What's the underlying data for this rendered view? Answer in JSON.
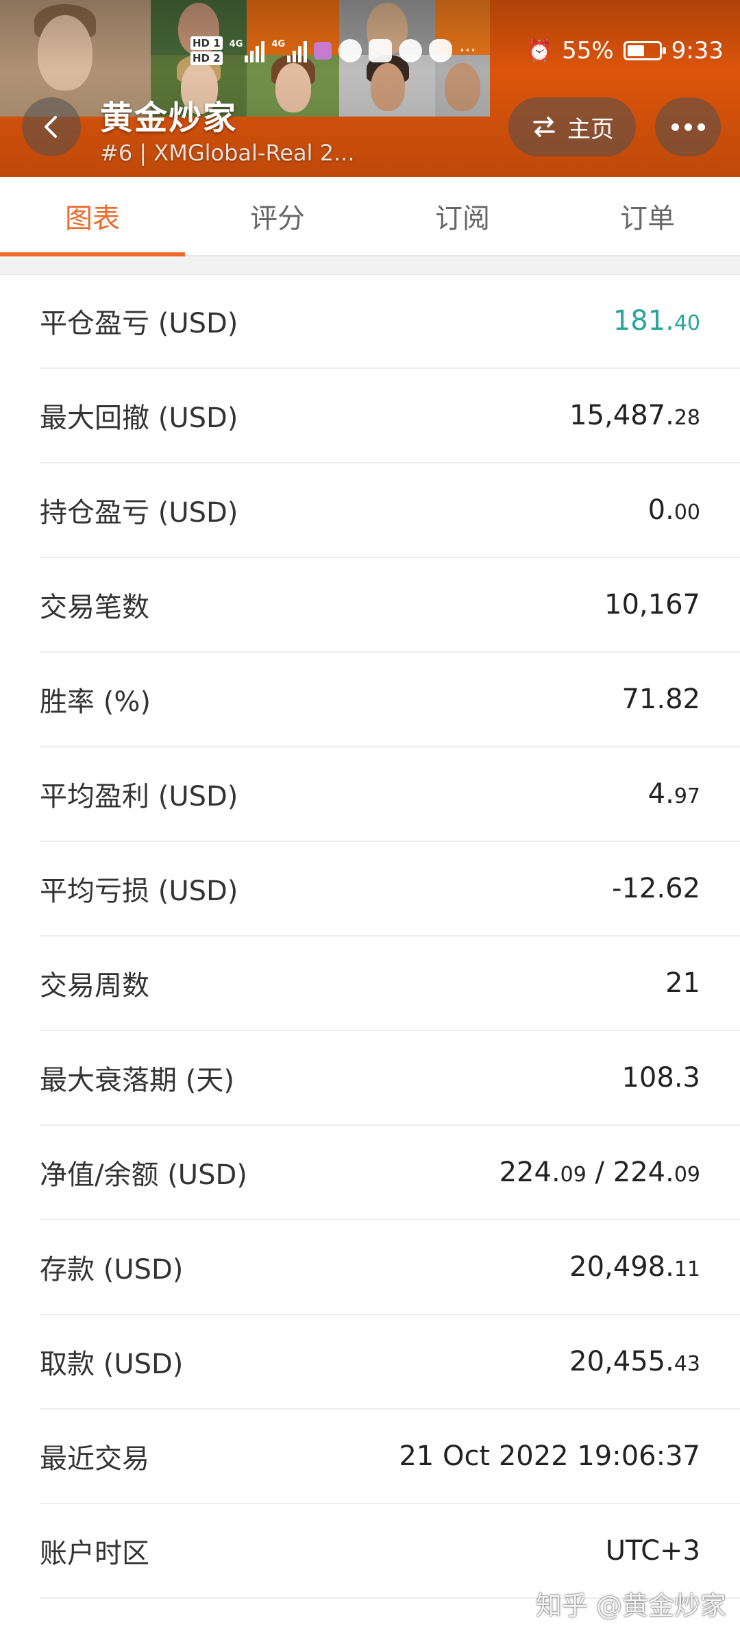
{
  "status_bar": {
    "sim1": "HD 1",
    "sim2": "HD 2",
    "network1": "4G",
    "network2": "4G",
    "more": "···",
    "battery_level": 0.55,
    "battery_text": "55%",
    "time": "9:33"
  },
  "header": {
    "title": "黄金炒家",
    "subtitle": "#6 | XMGlobal-Real 2...",
    "home_label": "主页",
    "accent_color": "#e8590c"
  },
  "tabs": [
    {
      "label": "图表",
      "active": true
    },
    {
      "label": "评分",
      "active": false
    },
    {
      "label": "订阅",
      "active": false
    },
    {
      "label": "订单",
      "active": false
    }
  ],
  "stats": [
    {
      "label": "平仓盈亏 (USD)",
      "int": "181.",
      "frac": "40",
      "tone": "positive"
    },
    {
      "label": "最大回撤 (USD)",
      "int": "15,487.",
      "frac": "28",
      "tone": ""
    },
    {
      "label": "持仓盈亏 (USD)",
      "int": "0.",
      "frac": "00",
      "tone": ""
    },
    {
      "label": "交易笔数",
      "int": "10,167",
      "frac": "",
      "tone": ""
    },
    {
      "label": "胜率 (%)",
      "int": "71.82",
      "frac": "",
      "tone": ""
    },
    {
      "label": "平均盈利 (USD)",
      "int": "4.",
      "frac": "97",
      "tone": ""
    },
    {
      "label": "平均亏损 (USD)",
      "int": "-12.62",
      "frac": "",
      "tone": ""
    },
    {
      "label": "交易周数",
      "int": "21",
      "frac": "",
      "tone": ""
    },
    {
      "label": "最大衰落期 (天)",
      "int": "108.3",
      "frac": "",
      "tone": ""
    },
    {
      "label": "净值/余额 (USD)",
      "int": "224.",
      "frac": "09",
      "int2": " / 224.",
      "frac2": "09",
      "tone": ""
    },
    {
      "label": "存款 (USD)",
      "int": "20,498.",
      "frac": "11",
      "tone": ""
    },
    {
      "label": "取款 (USD)",
      "int": "20,455.",
      "frac": "43",
      "tone": ""
    },
    {
      "label": "最近交易",
      "int": "21 Oct 2022 19:06:37",
      "frac": "",
      "tone": ""
    },
    {
      "label": "账户时区",
      "int": "UTC+3",
      "frac": "",
      "tone": ""
    }
  ],
  "watermark": "知乎 @黄金炒家",
  "colors": {
    "accent": "#ee6a2c",
    "positive": "#26a69a"
  }
}
